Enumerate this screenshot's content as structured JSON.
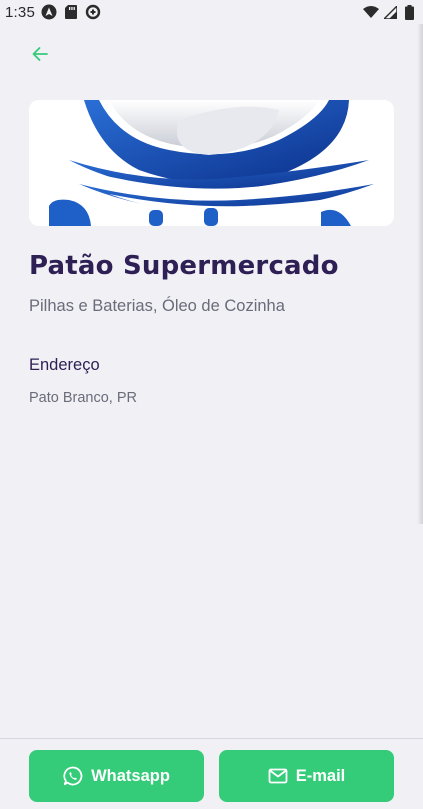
{
  "status_bar": {
    "time": "1:35",
    "left_icons": [
      "android-auto-icon",
      "sd-card-icon",
      "data-saver-icon"
    ],
    "right_icons": [
      "wifi-icon",
      "signal-icon",
      "battery-icon"
    ]
  },
  "header": {
    "back_icon": "arrow-left-icon"
  },
  "point": {
    "banner_alt": "store-banner-image",
    "name": "Patão Supermercado",
    "categories": "Pilhas e Baterias, Óleo de Cozinha",
    "address_heading": "Endereço",
    "address_value": "Pato Branco, PR"
  },
  "footer": {
    "whatsapp_label": "Whatsapp",
    "email_label": "E-mail"
  },
  "colors": {
    "background": "#f0f0f5",
    "accent": "#34cb79",
    "title": "#2e1f54",
    "muted": "#6b6c7a"
  }
}
